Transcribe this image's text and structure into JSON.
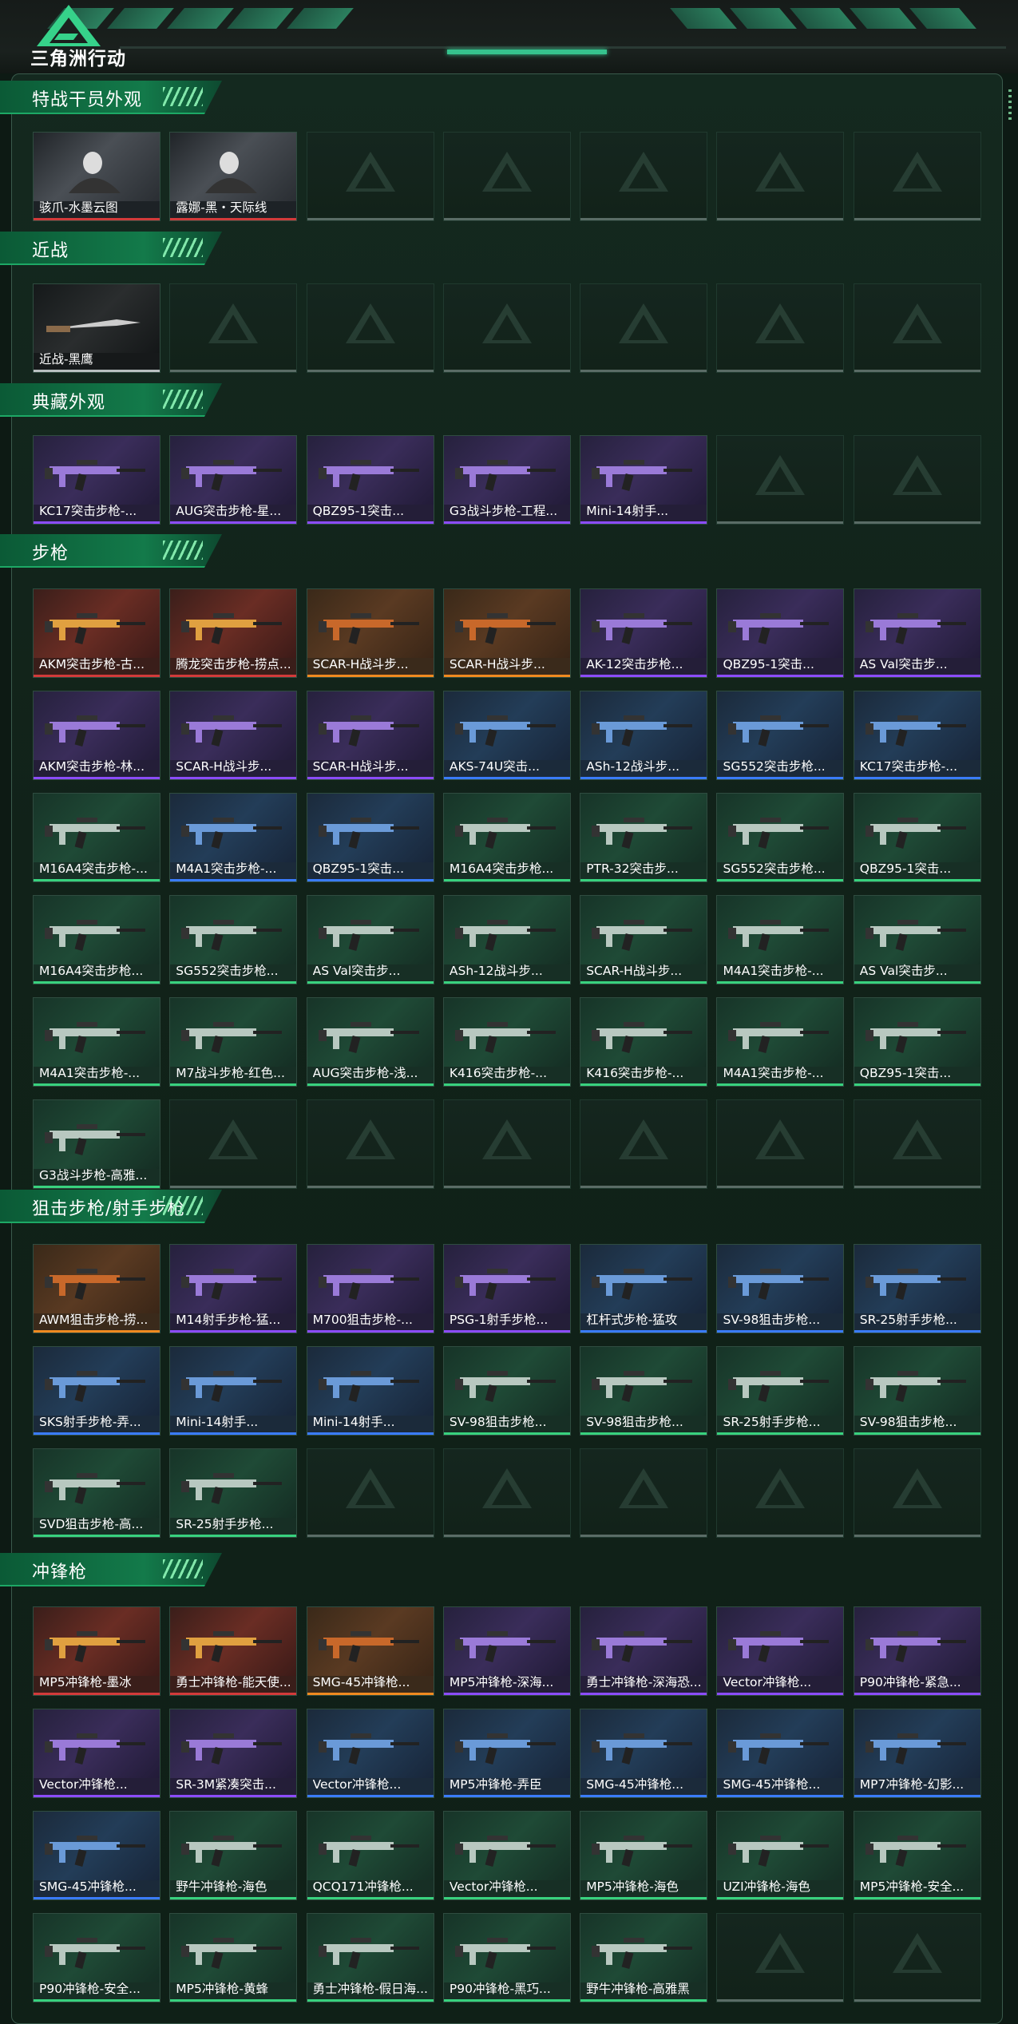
{
  "header": {
    "game_title": "三角洲行动"
  },
  "sections": [
    {
      "title": "特战干员外观",
      "items": [
        {
          "label": "骇爪-水墨云图",
          "rarity": "photo"
        },
        {
          "label": "露娜-黑・天际线",
          "rarity": "photo"
        }
      ],
      "empty_slots": 5
    },
    {
      "title": "近战",
      "items": [
        {
          "label": "近战-黑鹰",
          "rarity": "white"
        }
      ],
      "empty_slots": 6
    },
    {
      "title": "典藏外观",
      "items": [
        {
          "label": "KC17突击步枪-...",
          "rarity": "purple"
        },
        {
          "label": "AUG突击步枪-星...",
          "rarity": "purple"
        },
        {
          "label": "QBZ95-1突击...",
          "rarity": "purple"
        },
        {
          "label": "G3战斗步枪-工程...",
          "rarity": "purple"
        },
        {
          "label": "Mini-14射手...",
          "rarity": "purple"
        }
      ],
      "empty_slots": 2
    },
    {
      "title": "步枪",
      "items": [
        {
          "label": "AKM突击步枪-古...",
          "rarity": "red"
        },
        {
          "label": "腾龙突击步枪-捞点...",
          "rarity": "red"
        },
        {
          "label": "SCAR-H战斗步...",
          "rarity": "orange"
        },
        {
          "label": "SCAR-H战斗步...",
          "rarity": "orange"
        },
        {
          "label": "AK-12突击步枪...",
          "rarity": "purple"
        },
        {
          "label": "QBZ95-1突击...",
          "rarity": "purple"
        },
        {
          "label": "AS Val突击步...",
          "rarity": "purple"
        },
        {
          "label": "AKM突击步枪-林...",
          "rarity": "purple"
        },
        {
          "label": "SCAR-H战斗步...",
          "rarity": "purple"
        },
        {
          "label": "SCAR-H战斗步...",
          "rarity": "purple"
        },
        {
          "label": "AKS-74U突击...",
          "rarity": "blue"
        },
        {
          "label": "ASh-12战斗步...",
          "rarity": "blue"
        },
        {
          "label": "SG552突击步枪...",
          "rarity": "blue"
        },
        {
          "label": "KC17突击步枪-...",
          "rarity": "blue"
        },
        {
          "label": "M16A4突击步枪-...",
          "rarity": "green"
        },
        {
          "label": "M4A1突击步枪-...",
          "rarity": "blue"
        },
        {
          "label": "QBZ95-1突击...",
          "rarity": "blue"
        },
        {
          "label": "M16A4突击步枪...",
          "rarity": "green"
        },
        {
          "label": "PTR-32突击步...",
          "rarity": "green"
        },
        {
          "label": "SG552突击步枪...",
          "rarity": "green"
        },
        {
          "label": "QBZ95-1突击...",
          "rarity": "green"
        },
        {
          "label": "M16A4突击步枪...",
          "rarity": "green"
        },
        {
          "label": "SG552突击步枪...",
          "rarity": "green"
        },
        {
          "label": "AS Val突击步...",
          "rarity": "green"
        },
        {
          "label": "ASh-12战斗步...",
          "rarity": "green"
        },
        {
          "label": "SCAR-H战斗步...",
          "rarity": "green"
        },
        {
          "label": "M4A1突击步枪-...",
          "rarity": "green"
        },
        {
          "label": "AS Val突击步...",
          "rarity": "green"
        },
        {
          "label": "M4A1突击步枪-...",
          "rarity": "green"
        },
        {
          "label": "M7战斗步枪-红色...",
          "rarity": "green"
        },
        {
          "label": "AUG突击步枪-浅...",
          "rarity": "green"
        },
        {
          "label": "K416突击步枪-...",
          "rarity": "green"
        },
        {
          "label": "K416突击步枪-...",
          "rarity": "green"
        },
        {
          "label": "M4A1突击步枪-...",
          "rarity": "green"
        },
        {
          "label": "QBZ95-1突击...",
          "rarity": "green"
        },
        {
          "label": "G3战斗步枪-高雅...",
          "rarity": "green"
        }
      ],
      "empty_slots": 6
    },
    {
      "title": "狙击步枪/射手步枪",
      "items": [
        {
          "label": "AWM狙击步枪-捞...",
          "rarity": "orange"
        },
        {
          "label": "M14射手步枪-猛...",
          "rarity": "purple"
        },
        {
          "label": "M700狙击步枪-...",
          "rarity": "purple"
        },
        {
          "label": "PSG-1射手步枪...",
          "rarity": "purple"
        },
        {
          "label": "杠杆式步枪-猛攻",
          "rarity": "blue"
        },
        {
          "label": "SV-98狙击步枪...",
          "rarity": "blue"
        },
        {
          "label": "SR-25射手步枪...",
          "rarity": "blue"
        },
        {
          "label": "SKS射手步枪-弄...",
          "rarity": "blue"
        },
        {
          "label": "Mini-14射手...",
          "rarity": "blue"
        },
        {
          "label": "Mini-14射手...",
          "rarity": "blue"
        },
        {
          "label": "SV-98狙击步枪...",
          "rarity": "green"
        },
        {
          "label": "SV-98狙击步枪...",
          "rarity": "green"
        },
        {
          "label": "SR-25射手步枪...",
          "rarity": "green"
        },
        {
          "label": "SV-98狙击步枪...",
          "rarity": "green"
        },
        {
          "label": "SVD狙击步枪-高...",
          "rarity": "green"
        },
        {
          "label": "SR-25射手步枪...",
          "rarity": "green"
        }
      ],
      "empty_slots": 5
    },
    {
      "title": "冲锋枪",
      "items": [
        {
          "label": "MP5冲锋枪-墨冰",
          "rarity": "red"
        },
        {
          "label": "勇士冲锋枪-能天使...",
          "rarity": "red"
        },
        {
          "label": "SMG-45冲锋枪...",
          "rarity": "orange"
        },
        {
          "label": "MP5冲锋枪-深海...",
          "rarity": "purple"
        },
        {
          "label": "勇士冲锋枪-深海恐...",
          "rarity": "purple"
        },
        {
          "label": "Vector冲锋枪...",
          "rarity": "purple"
        },
        {
          "label": "P90冲锋枪-紧急...",
          "rarity": "purple"
        },
        {
          "label": "Vector冲锋枪...",
          "rarity": "purple"
        },
        {
          "label": "SR-3M紧凑突击...",
          "rarity": "purple"
        },
        {
          "label": "Vector冲锋枪...",
          "rarity": "blue"
        },
        {
          "label": "MP5冲锋枪-弄臣",
          "rarity": "blue"
        },
        {
          "label": "SMG-45冲锋枪...",
          "rarity": "blue"
        },
        {
          "label": "SMG-45冲锋枪...",
          "rarity": "blue"
        },
        {
          "label": "MP7冲锋枪-幻影...",
          "rarity": "blue"
        },
        {
          "label": "SMG-45冲锋枪...",
          "rarity": "blue"
        },
        {
          "label": "野牛冲锋枪-海色",
          "rarity": "green"
        },
        {
          "label": "QCQ171冲锋枪...",
          "rarity": "green"
        },
        {
          "label": "Vector冲锋枪...",
          "rarity": "green"
        },
        {
          "label": "MP5冲锋枪-海色",
          "rarity": "green"
        },
        {
          "label": "UZI冲锋枪-海色",
          "rarity": "green"
        },
        {
          "label": "MP5冲锋枪-安全...",
          "rarity": "green"
        },
        {
          "label": "P90冲锋枪-安全...",
          "rarity": "green"
        },
        {
          "label": "MP5冲锋枪-黄蜂",
          "rarity": "green"
        },
        {
          "label": "勇士冲锋枪-假日海...",
          "rarity": "green"
        },
        {
          "label": "P90冲锋枪-黑巧...",
          "rarity": "green"
        },
        {
          "label": "野牛冲锋枪-高雅黑",
          "rarity": "green"
        }
      ],
      "empty_slots": 2
    }
  ],
  "colors": {
    "accent_green": "#1da865",
    "rarity_red": "#d23a3a",
    "rarity_orange": "#f08a20",
    "rarity_purple": "#8c4cff",
    "rarity_blue": "#3a7cff",
    "rarity_green": "#38d27e"
  }
}
